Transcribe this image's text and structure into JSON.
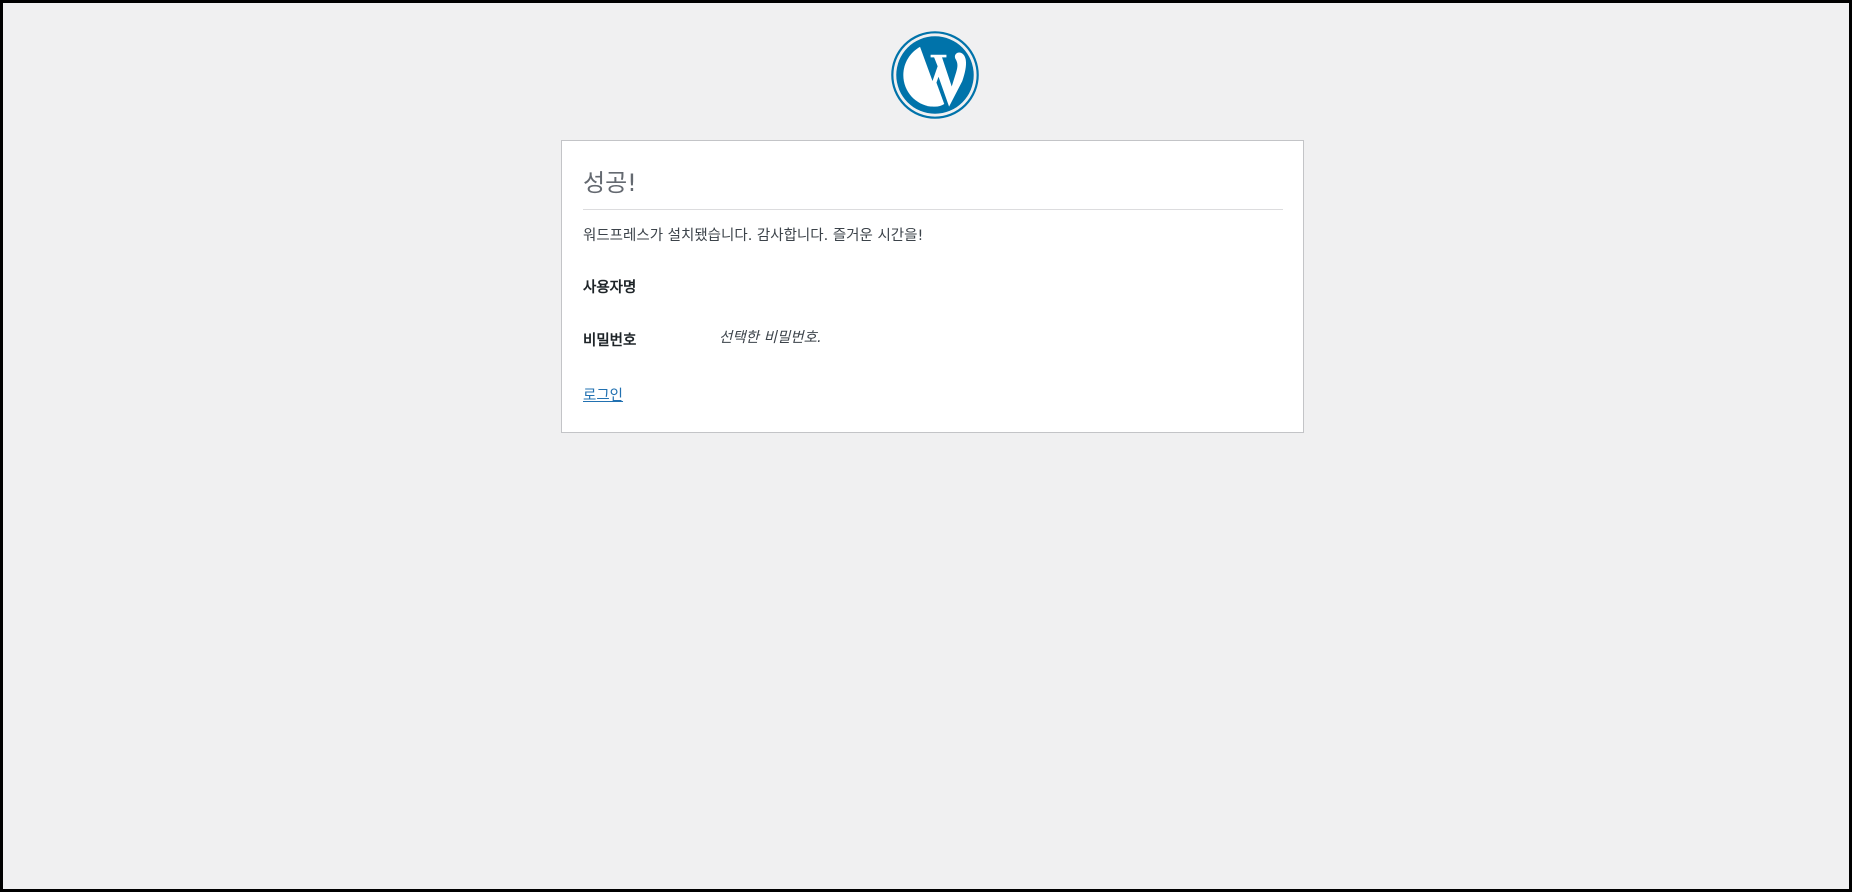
{
  "header": {
    "logo_icon": "wordpress-logo-icon",
    "logo_color": "#0073aa"
  },
  "card": {
    "title": "성공!",
    "message": "워드프레스가 설치됐습니다. 감사합니다. 즐거운 시간을!",
    "fields": {
      "username_label": "사용자명",
      "username_value": "",
      "password_label": "비밀번호",
      "password_value": "선택한 비밀번호."
    },
    "login_link": "로그인"
  },
  "colors": {
    "page_background": "#f0f0f1",
    "card_background": "#ffffff",
    "link": "#2271b1",
    "title": "#646970"
  }
}
